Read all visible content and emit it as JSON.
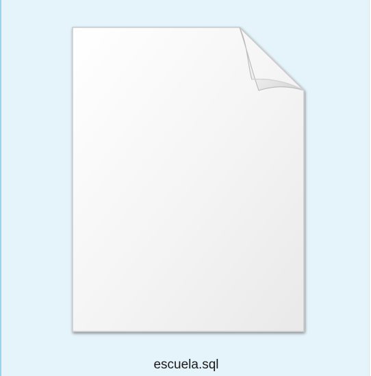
{
  "file": {
    "name": "escuela.sql",
    "icon": "generic-document-icon",
    "selected": true
  },
  "colors": {
    "selection_background": "#e5f3fb",
    "selection_border": "#99d1f0",
    "page": "#f2f2f2",
    "page_fold": "#dcdcdc"
  }
}
